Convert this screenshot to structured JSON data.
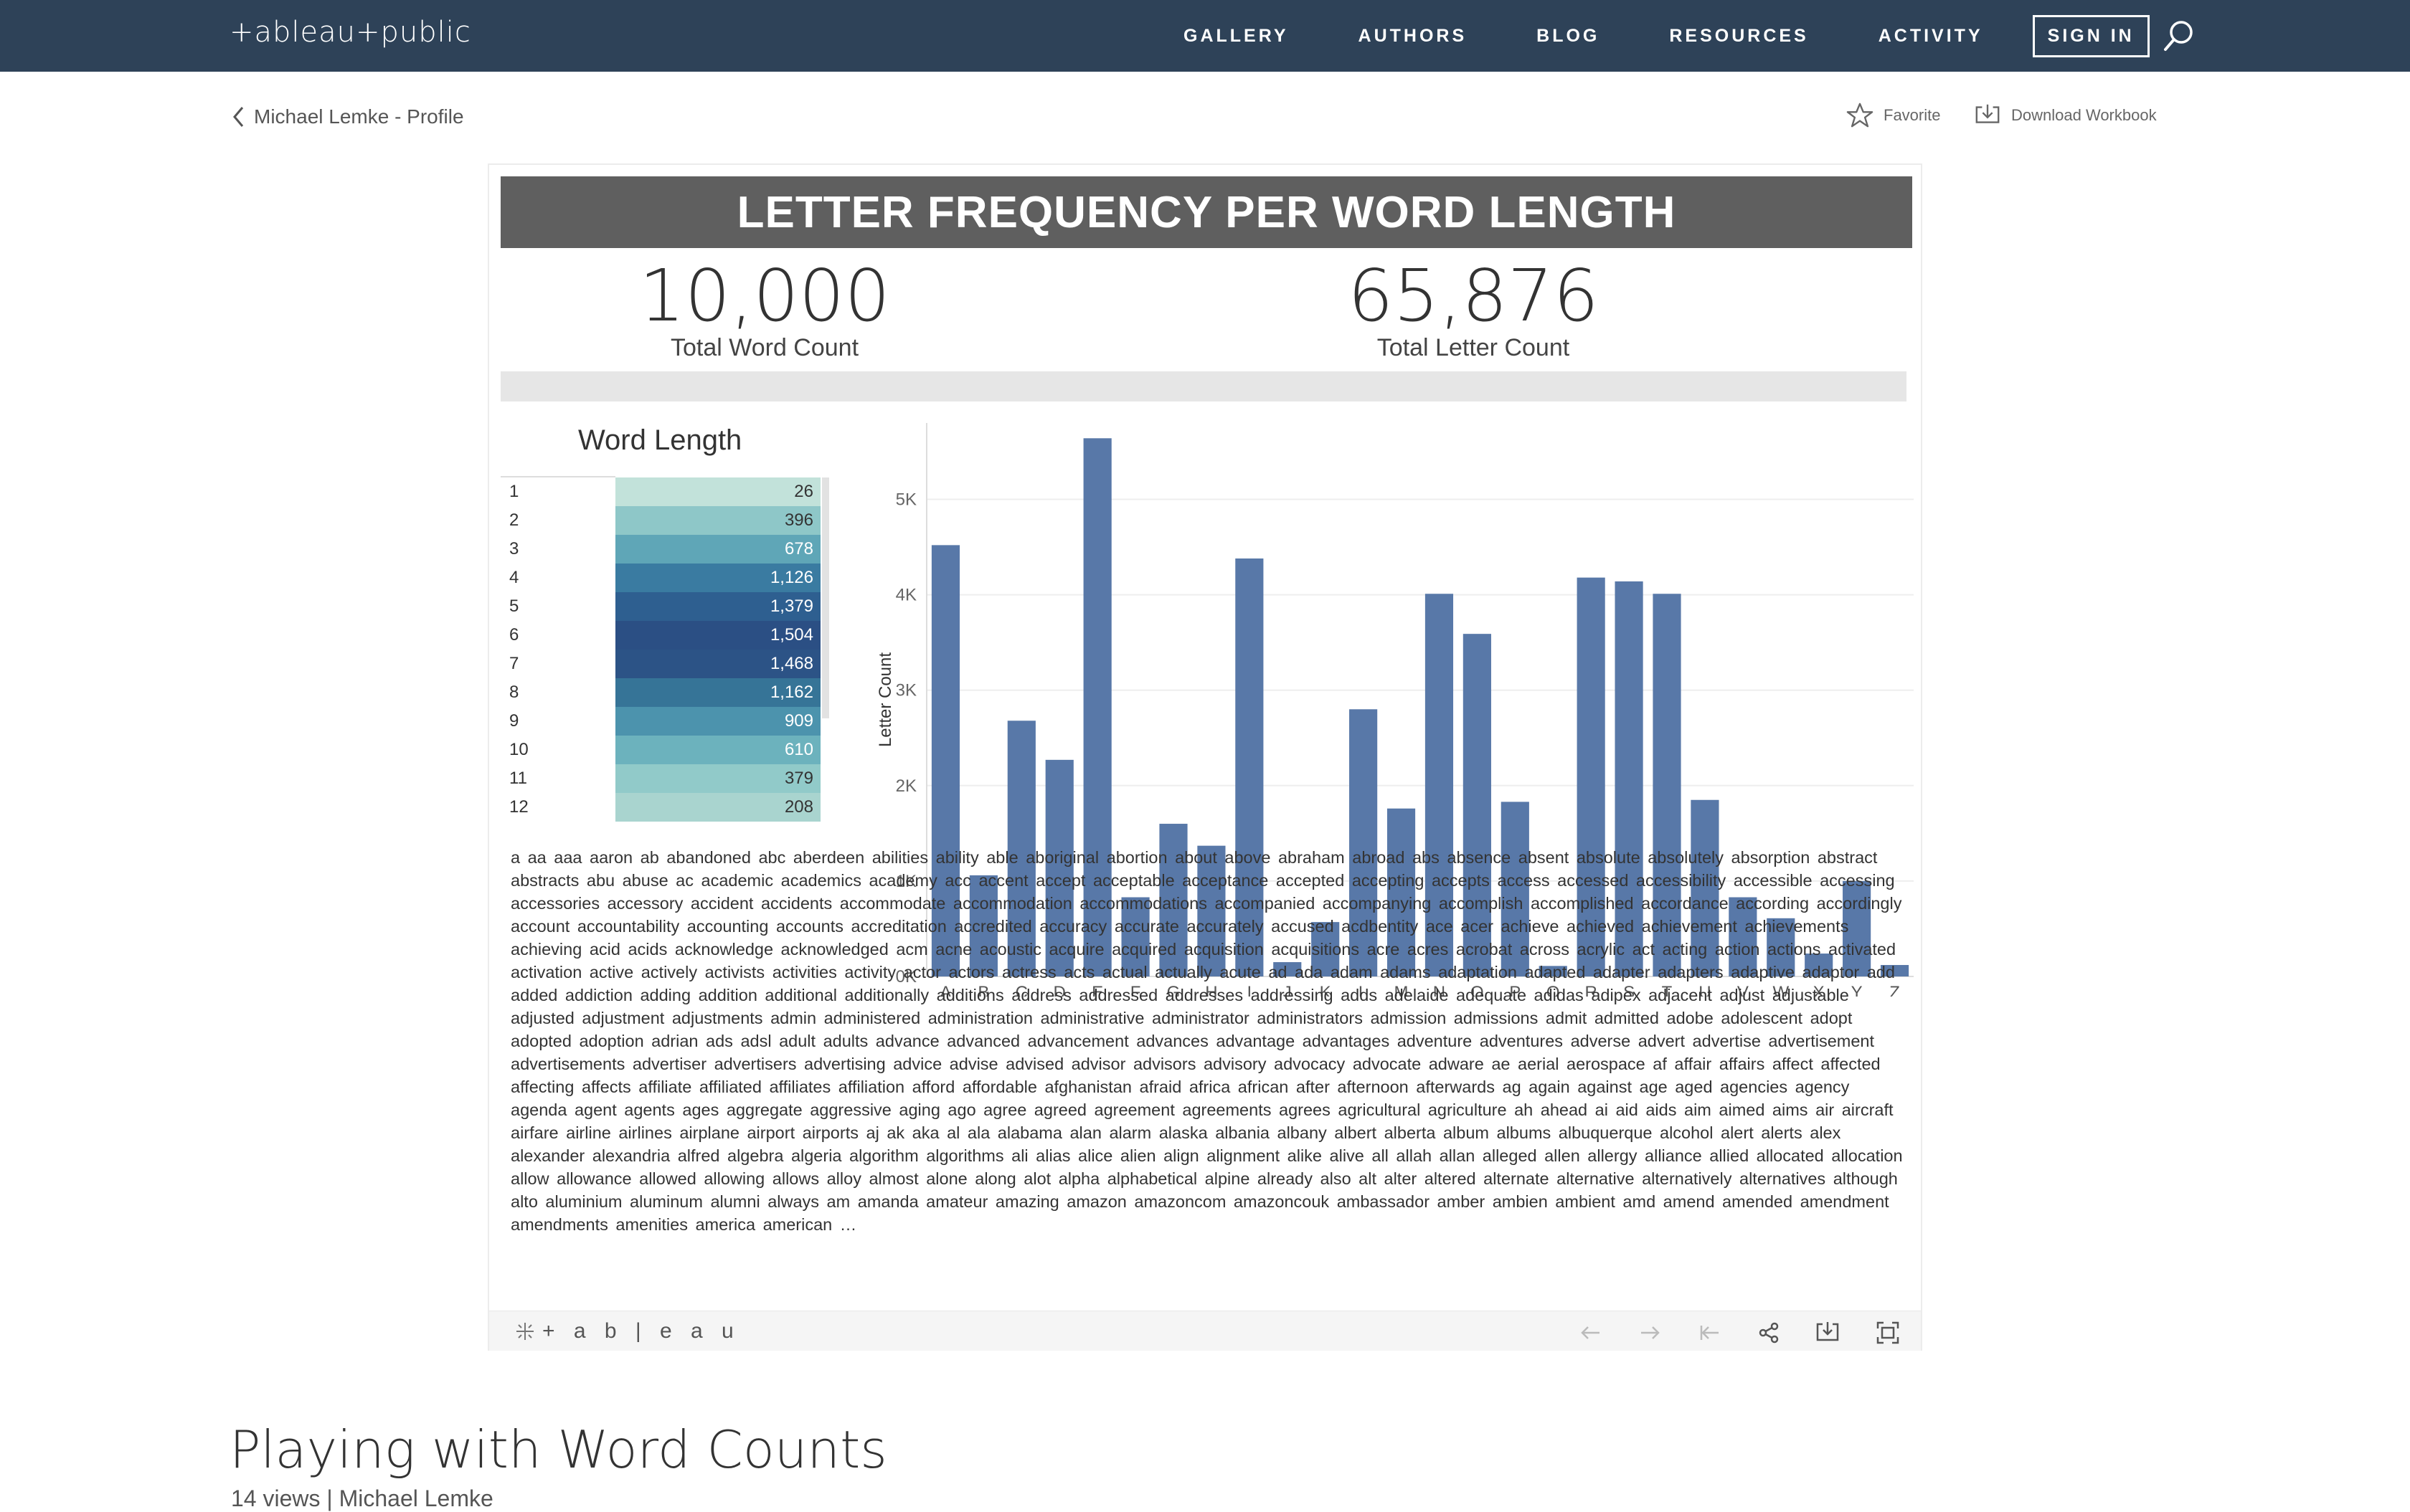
{
  "nav": {
    "logo": "+ableau+public",
    "items": [
      "GALLERY",
      "AUTHORS",
      "BLOG",
      "RESOURCES",
      "ACTIVITY"
    ],
    "signin": "SIGN IN"
  },
  "subbar": {
    "back_label": "Michael Lemke - Profile",
    "favorite_label": "Favorite",
    "download_label": "Download Workbook"
  },
  "viz": {
    "title": "LETTER FREQUENCY PER WORD LENGTH",
    "kpi_words_value": "10,000",
    "kpi_words_label": "Total Word Count",
    "kpi_letters_value": "65,876",
    "kpi_letters_label": "Total Letter Count",
    "word_length_title": "Word Length",
    "word_length_rows": [
      {
        "len": "1",
        "count": "26",
        "color": "#c2e2da"
      },
      {
        "len": "2",
        "count": "396",
        "color": "#8ec7c8"
      },
      {
        "len": "3",
        "count": "678",
        "color": "#5fa6b7"
      },
      {
        "len": "4",
        "count": "1,126",
        "color": "#3a7ba1"
      },
      {
        "len": "5",
        "count": "1,379",
        "color": "#2e5f90"
      },
      {
        "len": "6",
        "count": "1,504",
        "color": "#2b4f84"
      },
      {
        "len": "7",
        "count": "1,468",
        "color": "#2c5386"
      },
      {
        "len": "8",
        "count": "1,162",
        "color": "#367497"
      },
      {
        "len": "9",
        "count": "909",
        "color": "#4c93ad"
      },
      {
        "len": "10",
        "count": "610",
        "color": "#6cb2bd"
      },
      {
        "len": "11",
        "count": "379",
        "color": "#91cac9"
      },
      {
        "len": "12",
        "count": "208",
        "color": "#a9d4cf"
      }
    ],
    "words_text": "a  aa  aaa  aaron  ab  abandoned  abc  aberdeen  abilities  ability  able  aboriginal  abortion  about  above  abraham  abroad  abs  absence  absent  absolute  absolutely  absorption  abstract  abstracts  abu  abuse  ac  academic  academics  academy  acc  accent  accept  acceptable  acceptance  accepted  accepting  accepts  access  accessed  accessibility  accessible  accessing  accessories  accessory  accident  accidents  accommodate  accommodation  accommodations  accompanied  accompanying  accomplish  accomplished  accordance  according  accordingly  account  accountability  accounting  accounts  accreditation  accredited  accuracy  accurate  accurately  accused  acdbentity  ace  acer  achieve  achieved  achievement  achievements  achieving  acid  acids  acknowledge  acknowledged  acm  acne  acoustic  acquire  acquired  acquisition  acquisitions  acre  acres  acrobat  across  acrylic  act  acting  action  actions  activated  activation  active  actively  activists  activities  activity  actor  actors  actress  acts  actual  actually  acute  ad  ada  adam  adams  adaptation  adapted  adapter  adapters  adaptive  adaptor  add  added  addiction  adding  addition  additional  additionally  additions  address  addressed  addresses  addressing  adds  adelaide  adequate  adidas  adipex  adjacent  adjust  adjustable  adjusted  adjustment  adjustments  admin  administered  administration  administrative  administrator  administrators  admission  admissions  admit  admitted  adobe  adolescent  adopt  adopted  adoption  adrian  ads  adsl  adult  adults  advance  advanced  advancement  advances  advantage  advantages  adventure  adventures  adverse  advert  advertise  advertisement  advertisements  advertiser  advertisers  advertising  advice  advise  advised  advisor  advisors  advisory  advocacy  advocate  adware  ae  aerial  aerospace  af  affair  affairs  affect  affected  affecting  affects  affiliate  affiliated  affiliates  affiliation  afford  affordable  afghanistan  afraid  africa  african  after  afternoon  afterwards  ag  again  against  age  aged  agencies  agency  agenda  agent  agents  ages  aggregate  aggressive  aging  ago  agree  agreed  agreement  agreements  agrees  agricultural  agriculture  ah  ahead  ai  aid  aids  aim  aimed  aims  air  aircraft  airfare  airline  airlines  airplane  airport  airports  aj  ak  aka  al  ala  alabama  alan  alarm  alaska  albania  albany  albert  alberta  album  albums  albuquerque  alcohol  alert  alerts  alex  alexander  alexandria  alfred  algebra  algeria  algorithm  algorithms  ali  alias  alice  alien  align  alignment  alike  alive  all  allah  allan  alleged  allen  allergy  alliance  allied  allocated  allocation  allow  allowance  allowed  allowing  allows  alloy  almost  alone  along  alot  alpha  alphabetical  alpine  already  also  alt  alter  altered  alternate  alternative  alternatively  alternatives  although  alto  aluminium  aluminum  alumni  always  am  amanda  amateur  amazing  amazon  amazoncom  amazoncouk  ambassador  amber  ambien  ambient  amd  amend  amended  amendment  amendments  amenities  america  american  …",
    "toolbar_logo": "+ a b | e a u"
  },
  "chart_data": {
    "type": "bar",
    "categories": [
      "A",
      "B",
      "C",
      "D",
      "E",
      "F",
      "G",
      "H",
      "I",
      "J",
      "K",
      "L",
      "M",
      "N",
      "O",
      "P",
      "Q",
      "R",
      "S",
      "T",
      "U",
      "V",
      "W",
      "X",
      "Y",
      "Z"
    ],
    "values": [
      4520,
      1060,
      2680,
      2270,
      5640,
      830,
      1600,
      1370,
      4380,
      150,
      570,
      2800,
      1760,
      4010,
      3590,
      1830,
      110,
      4180,
      4140,
      4010,
      1850,
      830,
      610,
      240,
      1000,
      120
    ],
    "ylabel": "Letter Count",
    "ylim": [
      0,
      5800
    ],
    "yticks": [
      "0K",
      "1K",
      "2K",
      "3K",
      "4K",
      "5K"
    ],
    "color": "#5878a8"
  },
  "footer": {
    "heading": "Playing with Word Counts",
    "meta": "14 views | Michael Lemke"
  }
}
